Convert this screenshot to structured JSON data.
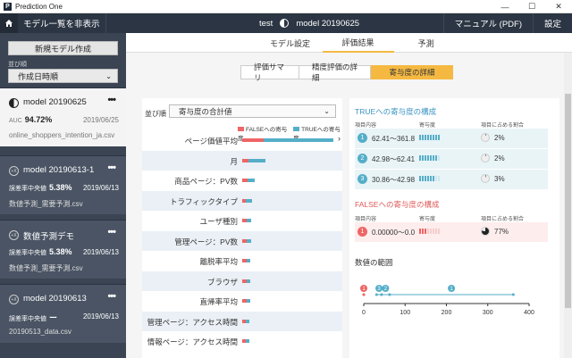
{
  "window": {
    "app_title": "Prediction One",
    "logo_letter": "P",
    "controls": {
      "minimize": "—",
      "maximize": "☐",
      "close": "✕"
    }
  },
  "topbar": {
    "toggle_list_label": "モデル一覧を非表示",
    "project_name": "test",
    "model_name": "model 20190625",
    "manual_label": "マニュアル (PDF)",
    "settings_label": "設定"
  },
  "sidebar": {
    "new_model_label": "新規モデル作成",
    "sort_label": "並び順",
    "sort_value": "作成日時順",
    "models": [
      {
        "name": "model 20190625",
        "metric_label": "AUC",
        "metric_value": "94.72%",
        "date": "2019/06/25",
        "file": "online_shoppers_intention_ja.csv",
        "icon": "half-circle-icon",
        "active": true
      },
      {
        "name": "model 20190613-1",
        "metric_label": "誤差率中央値",
        "metric_value": "5.38%",
        "date": "2019/06/13",
        "file": "数値予測_需要予測.csv",
        "icon": "numeric-model-icon",
        "active": false
      },
      {
        "name": "数値予測デモ",
        "metric_label": "誤差率中央値",
        "metric_value": "5.38%",
        "date": "2019/06/13",
        "file": "数値予測_需要予測.csv",
        "icon": "numeric-model-icon",
        "active": false
      },
      {
        "name": "model 20190613",
        "metric_label": "誤差率中央値",
        "metric_value": "ー",
        "date": "2019/06/13",
        "file": "20190513_data.csv",
        "icon": "numeric-model-icon",
        "active": false
      }
    ],
    "more_label": "•••"
  },
  "main": {
    "tabs": [
      "モデル設定",
      "評価結果",
      "予測"
    ],
    "active_tab": "評価結果",
    "subtabs": [
      "評価サマリ",
      "精度評価の詳細",
      "寄与度の詳細"
    ],
    "active_subtab": "寄与度の詳細"
  },
  "left_panel": {
    "sort_label": "並び順",
    "sort_value": "寄与度の合計値",
    "legend_false": "FALSEへの寄与度",
    "legend_true": "TRUEへの寄与度",
    "features": [
      {
        "name": "ページ価値平均",
        "false_share": 0.24,
        "true_share": 0.76,
        "width": 100
      },
      {
        "name": "月",
        "false_share": 0.25,
        "true_share": 0.75,
        "width": 26
      },
      {
        "name": "商品ページ：PV数",
        "false_share": 0.4,
        "true_share": 0.6,
        "width": 14
      },
      {
        "name": "トラフィックタイプ",
        "false_share": 0.4,
        "true_share": 0.6,
        "width": 11
      },
      {
        "name": "ユーザ種別",
        "false_share": 0.5,
        "true_share": 0.5,
        "width": 10
      },
      {
        "name": "管理ページ：PV数",
        "false_share": 0.5,
        "true_share": 0.5,
        "width": 10
      },
      {
        "name": "離脱率平均",
        "false_share": 0.5,
        "true_share": 0.5,
        "width": 9
      },
      {
        "name": "ブラウザ",
        "false_share": 0.5,
        "true_share": 0.5,
        "width": 9
      },
      {
        "name": "直帰率平均",
        "false_share": 0.5,
        "true_share": 0.5,
        "width": 9
      },
      {
        "name": "管理ページ：アクセス時間",
        "false_share": 0.5,
        "true_share": 0.5,
        "width": 8
      },
      {
        "name": "情報ページ：アクセス時間",
        "false_share": 0.5,
        "true_share": 0.5,
        "width": 8
      }
    ]
  },
  "right_panel": {
    "true_title": "TRUEへの寄与度の構成",
    "false_title": "FALSEへの寄与度の構成",
    "col_item": "項目内容",
    "col_contrib": "寄与度",
    "col_share": "項目に占める割合",
    "true_rows": [
      {
        "rank": "1",
        "range": "62.41〜361.8",
        "bars": 8,
        "pct": "2%"
      },
      {
        "rank": "2",
        "range": "42.98〜62.41",
        "bars": 7,
        "pct": "2%"
      },
      {
        "rank": "3",
        "range": "30.86〜42.98",
        "bars": 6,
        "pct": "3%"
      }
    ],
    "false_rows": [
      {
        "rank": "1",
        "range": "0.00000〜0.0",
        "bars": 3,
        "pct": "77%"
      }
    ],
    "num_range_title": "数値の範囲",
    "axis_ticks": [
      "0",
      "100",
      "200",
      "300",
      "400"
    ],
    "axis_max": 400,
    "markers": [
      {
        "label": "1",
        "kind": "false",
        "from": 0,
        "to": 0
      },
      {
        "label": "3",
        "kind": "true",
        "from": 30.86,
        "to": 42.98
      },
      {
        "label": "2",
        "kind": "true",
        "from": 42.98,
        "to": 62.41
      },
      {
        "label": "1",
        "kind": "true",
        "from": 62.41,
        "to": 361.8
      }
    ]
  },
  "colors": {
    "false": "#ee6565",
    "true": "#55aec8",
    "accent": "#f5b942"
  }
}
